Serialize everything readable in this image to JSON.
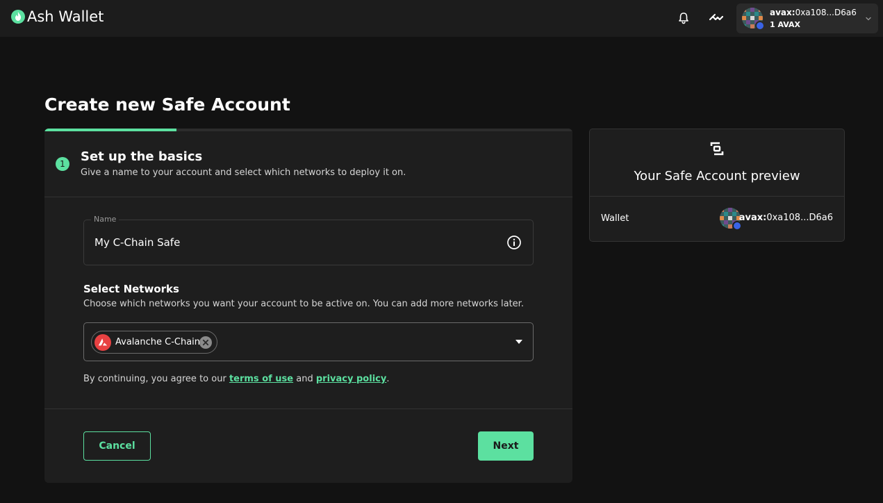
{
  "header": {
    "app_name": "Ash Wallet",
    "account": {
      "address_prefix": "avax:",
      "address": "0xa108...D6a6",
      "balance": "1 AVAX"
    }
  },
  "page": {
    "title": "Create new Safe Account"
  },
  "form": {
    "progress_fraction": 0.25,
    "step": {
      "number": "1",
      "title": "Set up the basics",
      "subtitle": "Give a name to your account and select which networks to deploy it on."
    },
    "name_field": {
      "label": "Name",
      "value": "My C-Chain Safe"
    },
    "networks": {
      "title": "Select Networks",
      "subtitle": "Choose which networks you want your account to be active on. You can add more networks later.",
      "selected": [
        "Avalanche C-Chain"
      ]
    },
    "terms": {
      "prefix": "By continuing, you agree to our",
      "terms_link": "terms of use",
      "and": "and",
      "privacy_link": "privacy policy",
      "suffix": "."
    },
    "buttons": {
      "cancel": "Cancel",
      "next": "Next"
    }
  },
  "preview": {
    "title": "Your Safe Account preview",
    "wallet_label": "Wallet",
    "address_prefix": "avax:",
    "address": "0xa108...D6a6"
  },
  "colors": {
    "accent": "#5ce0a0",
    "background": "#121212",
    "surface": "#1e1e1e",
    "avalanche_red": "#e84142"
  },
  "icons": {
    "logo": "flame-icon",
    "notifications": "bell-icon",
    "network": "wave-icon",
    "info": "info-icon",
    "remove": "close-circle-icon",
    "dropdown": "caret-down-icon",
    "safe": "safe-icon",
    "chevron": "chevron-down-icon"
  }
}
